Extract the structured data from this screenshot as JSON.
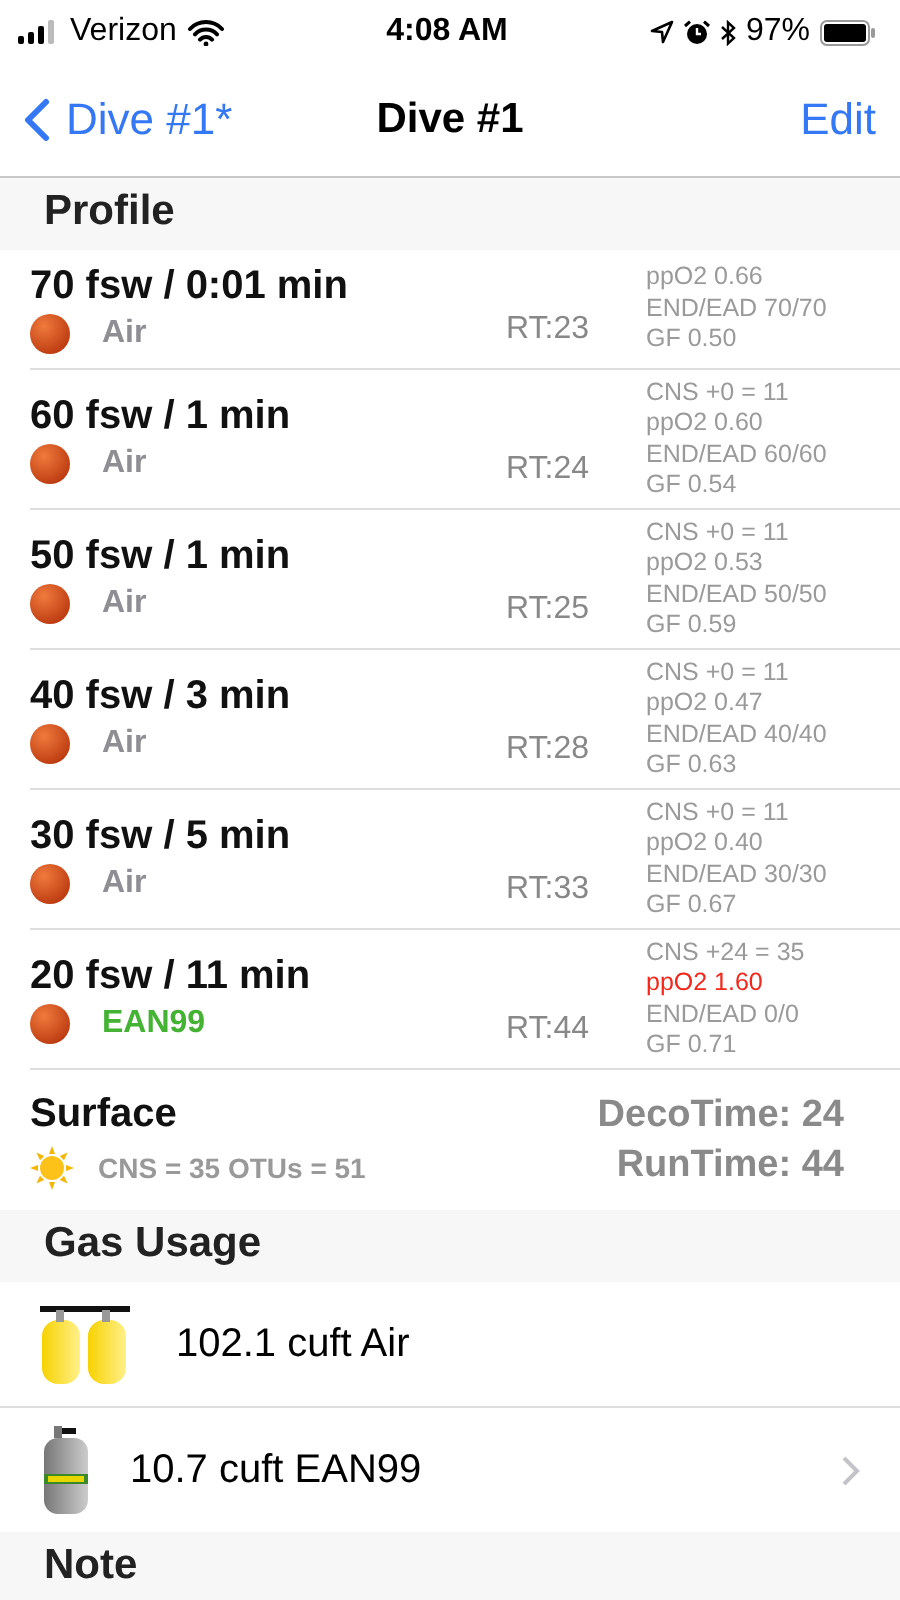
{
  "status_bar": {
    "carrier": "Verizon",
    "time": "4:08 AM",
    "battery": "97%"
  },
  "nav": {
    "back": "Dive #1*",
    "title": "Dive #1",
    "action": "Edit"
  },
  "profile": {
    "header": "Profile",
    "stops": [
      {
        "title": "70 fsw / 0:01 min",
        "gas": "Air",
        "color": "#8e8e93",
        "rt": "RT:23",
        "partial": true,
        "details": [
          {
            "text": "ppO2 0.66",
            "warning": false
          },
          {
            "text": "END/EAD 70/70",
            "warning": false
          },
          {
            "text": "GF 0.50",
            "warning": false
          }
        ]
      },
      {
        "title": "60 fsw / 1 min",
        "gas": "Air",
        "color": "#8e8e93",
        "rt": "RT:24",
        "partial": false,
        "details": [
          {
            "text": "CNS +0 = 11",
            "warning": false
          },
          {
            "text": "ppO2 0.60",
            "warning": false
          },
          {
            "text": "END/EAD 60/60",
            "warning": false
          },
          {
            "text": "GF 0.54",
            "warning": false
          }
        ]
      },
      {
        "title": "50 fsw / 1 min",
        "gas": "Air",
        "color": "#8e8e93",
        "rt": "RT:25",
        "partial": false,
        "details": [
          {
            "text": "CNS +0 = 11",
            "warning": false
          },
          {
            "text": "ppO2 0.53",
            "warning": false
          },
          {
            "text": "END/EAD 50/50",
            "warning": false
          },
          {
            "text": "GF 0.59",
            "warning": false
          }
        ]
      },
      {
        "title": "40 fsw / 3 min",
        "gas": "Air",
        "color": "#8e8e93",
        "rt": "RT:28",
        "partial": false,
        "details": [
          {
            "text": "CNS +0 = 11",
            "warning": false
          },
          {
            "text": "ppO2 0.47",
            "warning": false
          },
          {
            "text": "END/EAD 40/40",
            "warning": false
          },
          {
            "text": "GF 0.63",
            "warning": false
          }
        ]
      },
      {
        "title": "30 fsw / 5 min",
        "gas": "Air",
        "color": "#8e8e93",
        "rt": "RT:33",
        "partial": false,
        "details": [
          {
            "text": "CNS +0 = 11",
            "warning": false
          },
          {
            "text": "ppO2 0.40",
            "warning": false
          },
          {
            "text": "END/EAD 30/30",
            "warning": false
          },
          {
            "text": "GF 0.67",
            "warning": false
          }
        ]
      },
      {
        "title": "20 fsw / 11 min",
        "gas": "EAN99",
        "color": "#44b233",
        "rt": "RT:44",
        "partial": false,
        "details": [
          {
            "text": "CNS +24 = 35",
            "warning": false
          },
          {
            "text": "ppO2 1.60",
            "warning": true
          },
          {
            "text": "END/EAD 0/0",
            "warning": false
          },
          {
            "text": "GF 0.71",
            "warning": false
          }
        ]
      }
    ],
    "surface": {
      "title": "Surface",
      "summary": "CNS = 35 OTUs = 51",
      "deco_time": "DecoTime: 24",
      "run_time": "RunTime: 44"
    }
  },
  "gas_usage": {
    "header": "Gas Usage",
    "items": [
      {
        "kind": "twin",
        "label": "102.1 cuft Air",
        "chevron": false
      },
      {
        "kind": "single",
        "label": "10.7 cuft EAN99",
        "chevron": true
      }
    ]
  },
  "note": {
    "header": "Note"
  }
}
